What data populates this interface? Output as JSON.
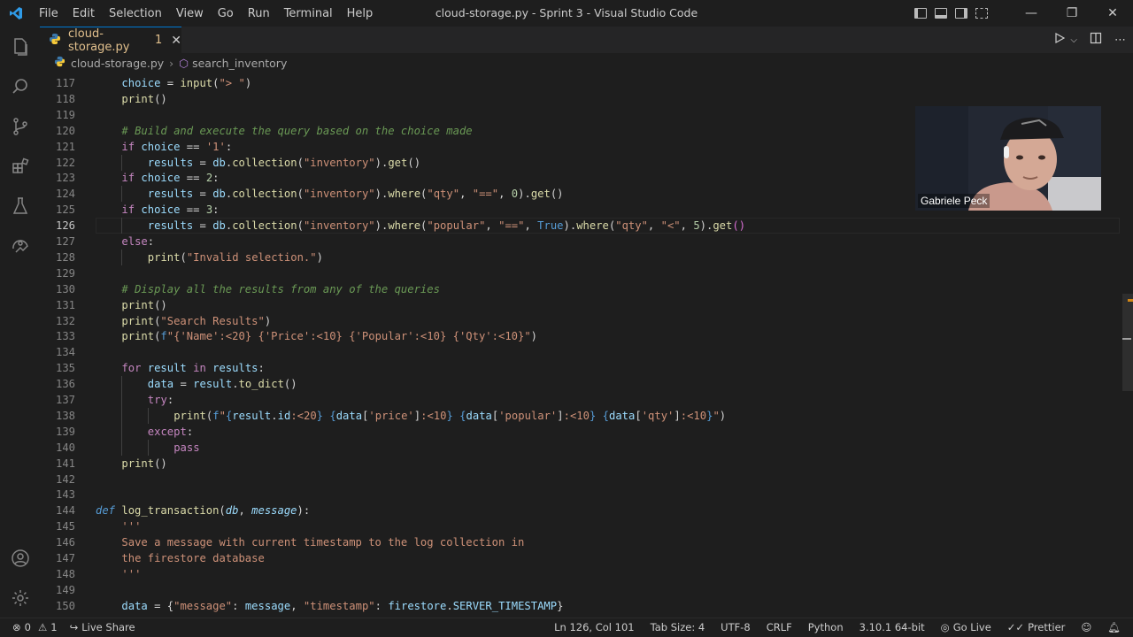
{
  "window": {
    "title": "cloud-storage.py - Sprint 3 - Visual Studio Code"
  },
  "menu": [
    "File",
    "Edit",
    "Selection",
    "View",
    "Go",
    "Run",
    "Terminal",
    "Help"
  ],
  "tab": {
    "label": "cloud-storage.py",
    "problems": "1"
  },
  "breadcrumb": {
    "file": "cloud-storage.py",
    "symbol": "search_inventory"
  },
  "webcam": {
    "name": "Gabriele Peck"
  },
  "status": {
    "errors": "0",
    "warnings": "1",
    "live_share": "Live Share",
    "position": "Ln 126, Col 101",
    "tab_size": "Tab Size: 4",
    "encoding": "UTF-8",
    "eol": "CRLF",
    "language": "Python",
    "interpreter": "3.10.1 64-bit",
    "go_live": "Go Live",
    "prettier": "Prettier"
  },
  "code": {
    "current_line": 126,
    "lines": [
      {
        "n": 117,
        "i": 1,
        "t": [
          [
            "v",
            "choice"
          ],
          [
            "p",
            " = "
          ],
          [
            "f",
            "input"
          ],
          [
            "p",
            "("
          ],
          [
            "s",
            "\"> \""
          ],
          [
            "p",
            ")"
          ]
        ]
      },
      {
        "n": 118,
        "i": 1,
        "t": [
          [
            "f",
            "print"
          ],
          [
            "p",
            "()"
          ]
        ]
      },
      {
        "n": 119,
        "i": 0,
        "t": []
      },
      {
        "n": 120,
        "i": 1,
        "t": [
          [
            "c",
            "# Build and execute the query based on the choice made"
          ]
        ]
      },
      {
        "n": 121,
        "i": 1,
        "t": [
          [
            "k",
            "if"
          ],
          [
            "v",
            " choice"
          ],
          [
            "p",
            " == "
          ],
          [
            "s",
            "'1'"
          ],
          [
            "p",
            ":"
          ]
        ]
      },
      {
        "n": 122,
        "i": 2,
        "t": [
          [
            "v",
            "results"
          ],
          [
            "p",
            " = "
          ],
          [
            "v",
            "db"
          ],
          [
            "p",
            "."
          ],
          [
            "f",
            "collection"
          ],
          [
            "p",
            "("
          ],
          [
            "s",
            "\"inventory\""
          ],
          [
            "p",
            ")."
          ],
          [
            "f",
            "get"
          ],
          [
            "p",
            "()"
          ]
        ]
      },
      {
        "n": 123,
        "i": 1,
        "t": [
          [
            "k",
            "if"
          ],
          [
            "v",
            " choice"
          ],
          [
            "p",
            " == "
          ],
          [
            "n",
            "2"
          ],
          [
            "p",
            ":"
          ]
        ]
      },
      {
        "n": 124,
        "i": 2,
        "t": [
          [
            "v",
            "results"
          ],
          [
            "p",
            " = "
          ],
          [
            "v",
            "db"
          ],
          [
            "p",
            "."
          ],
          [
            "f",
            "collection"
          ],
          [
            "p",
            "("
          ],
          [
            "s",
            "\"inventory\""
          ],
          [
            "p",
            ")."
          ],
          [
            "f",
            "where"
          ],
          [
            "p",
            "("
          ],
          [
            "s",
            "\"qty\""
          ],
          [
            "p",
            ", "
          ],
          [
            "s",
            "\"==\""
          ],
          [
            "p",
            ", "
          ],
          [
            "n",
            "0"
          ],
          [
            "p",
            ")."
          ],
          [
            "f",
            "get"
          ],
          [
            "p",
            "()"
          ]
        ]
      },
      {
        "n": 125,
        "i": 1,
        "t": [
          [
            "k",
            "if"
          ],
          [
            "v",
            " choice"
          ],
          [
            "p",
            " == "
          ],
          [
            "n",
            "3"
          ],
          [
            "p",
            ":"
          ]
        ]
      },
      {
        "n": 126,
        "i": 2,
        "t": [
          [
            "v",
            "results"
          ],
          [
            "p",
            " = "
          ],
          [
            "v",
            "db"
          ],
          [
            "p",
            "."
          ],
          [
            "f",
            "collection"
          ],
          [
            "p",
            "("
          ],
          [
            "s",
            "\"inventory\""
          ],
          [
            "p",
            ")."
          ],
          [
            "f",
            "where"
          ],
          [
            "p",
            "("
          ],
          [
            "s",
            "\"popular\""
          ],
          [
            "p",
            ", "
          ],
          [
            "s",
            "\"==\""
          ],
          [
            "p",
            ", "
          ],
          [
            "b",
            "True"
          ],
          [
            "p",
            ")."
          ],
          [
            "f",
            "where"
          ],
          [
            "p",
            "("
          ],
          [
            "s",
            "\"qty\""
          ],
          [
            "p",
            ", "
          ],
          [
            "s",
            "\"<\""
          ],
          [
            "p",
            ", "
          ],
          [
            "n",
            "5"
          ],
          [
            "p",
            ")."
          ],
          [
            "f",
            "get"
          ],
          [
            "br2",
            "()"
          ]
        ]
      },
      {
        "n": 127,
        "i": 1,
        "t": [
          [
            "k",
            "else"
          ],
          [
            "p",
            ":"
          ]
        ]
      },
      {
        "n": 128,
        "i": 2,
        "t": [
          [
            "f",
            "print"
          ],
          [
            "p",
            "("
          ],
          [
            "s",
            "\"Invalid selection.\""
          ],
          [
            "p",
            ")"
          ]
        ]
      },
      {
        "n": 129,
        "i": 0,
        "t": []
      },
      {
        "n": 130,
        "i": 1,
        "t": [
          [
            "c",
            "# Display all the results from any of the queries"
          ]
        ]
      },
      {
        "n": 131,
        "i": 1,
        "t": [
          [
            "f",
            "print"
          ],
          [
            "p",
            "()"
          ]
        ]
      },
      {
        "n": 132,
        "i": 1,
        "t": [
          [
            "f",
            "print"
          ],
          [
            "p",
            "("
          ],
          [
            "s",
            "\"Search Results\""
          ],
          [
            "p",
            ")"
          ]
        ]
      },
      {
        "n": 133,
        "i": 1,
        "t": [
          [
            "f",
            "print"
          ],
          [
            "p",
            "("
          ],
          [
            "b",
            "f"
          ],
          [
            "s",
            "\"{'Name':<20} {'Price':<10} {'Popular':<10} {'Qty':<10}\""
          ],
          [
            "p",
            ")"
          ]
        ]
      },
      {
        "n": 134,
        "i": 0,
        "t": []
      },
      {
        "n": 135,
        "i": 1,
        "t": [
          [
            "k",
            "for"
          ],
          [
            "v",
            " result"
          ],
          [
            "k",
            " in"
          ],
          [
            "v",
            " results"
          ],
          [
            "p",
            ":"
          ]
        ]
      },
      {
        "n": 136,
        "i": 2,
        "t": [
          [
            "v",
            "data"
          ],
          [
            "p",
            " = "
          ],
          [
            "v",
            "result"
          ],
          [
            "p",
            "."
          ],
          [
            "f",
            "to_dict"
          ],
          [
            "p",
            "()"
          ]
        ]
      },
      {
        "n": 137,
        "i": 2,
        "t": [
          [
            "k",
            "try"
          ],
          [
            "p",
            ":"
          ]
        ]
      },
      {
        "n": 138,
        "i": 3,
        "t": [
          [
            "f",
            "print"
          ],
          [
            "p",
            "("
          ],
          [
            "b",
            "f"
          ],
          [
            "s",
            "\""
          ],
          [
            "b",
            "{"
          ],
          [
            "v",
            "result"
          ],
          [
            "p",
            "."
          ],
          [
            "v",
            "id"
          ],
          [
            "s",
            ":<20"
          ],
          [
            "b",
            "}"
          ],
          [
            "s",
            " "
          ],
          [
            "b",
            "{"
          ],
          [
            "v",
            "data"
          ],
          [
            "p",
            "["
          ],
          [
            "s",
            "'price'"
          ],
          [
            "p",
            "]"
          ],
          [
            "s",
            ":<10"
          ],
          [
            "b",
            "}"
          ],
          [
            "s",
            " "
          ],
          [
            "b",
            "{"
          ],
          [
            "v",
            "data"
          ],
          [
            "p",
            "["
          ],
          [
            "s",
            "'popular'"
          ],
          [
            "p",
            "]"
          ],
          [
            "s",
            ":<10"
          ],
          [
            "b",
            "}"
          ],
          [
            "s",
            " "
          ],
          [
            "b",
            "{"
          ],
          [
            "v",
            "data"
          ],
          [
            "p",
            "["
          ],
          [
            "s",
            "'qty'"
          ],
          [
            "p",
            "]"
          ],
          [
            "s",
            ":<10"
          ],
          [
            "b",
            "}"
          ],
          [
            "s",
            "\""
          ],
          [
            "p",
            ")"
          ]
        ]
      },
      {
        "n": 139,
        "i": 2,
        "t": [
          [
            "k",
            "except"
          ],
          [
            "p",
            ":"
          ]
        ]
      },
      {
        "n": 140,
        "i": 3,
        "t": [
          [
            "k",
            "pass"
          ]
        ]
      },
      {
        "n": 141,
        "i": 1,
        "t": [
          [
            "f",
            "print"
          ],
          [
            "p",
            "()"
          ]
        ]
      },
      {
        "n": 142,
        "i": 0,
        "t": []
      },
      {
        "n": 143,
        "i": 0,
        "t": []
      },
      {
        "n": 144,
        "i": 0,
        "t": [
          [
            "kd",
            "def"
          ],
          [
            "p",
            " "
          ],
          [
            "f",
            "log_transaction"
          ],
          [
            "p",
            "("
          ],
          [
            "pa",
            "db"
          ],
          [
            "p",
            ", "
          ],
          [
            "pa",
            "message"
          ],
          [
            "p",
            "):"
          ]
        ]
      },
      {
        "n": 145,
        "i": 1,
        "t": [
          [
            "s",
            "'''"
          ]
        ]
      },
      {
        "n": 146,
        "i": 1,
        "t": [
          [
            "s",
            "Save a message with current timestamp to the log collection in"
          ]
        ]
      },
      {
        "n": 147,
        "i": 1,
        "t": [
          [
            "s",
            "the firestore database"
          ]
        ]
      },
      {
        "n": 148,
        "i": 1,
        "t": [
          [
            "s",
            "'''"
          ]
        ]
      },
      {
        "n": 149,
        "i": 0,
        "t": []
      },
      {
        "n": 150,
        "i": 1,
        "t": [
          [
            "v",
            "data"
          ],
          [
            "p",
            " = "
          ],
          [
            "p",
            "{"
          ],
          [
            "s",
            "\"message\""
          ],
          [
            "p",
            ": "
          ],
          [
            "v",
            "message"
          ],
          [
            "p",
            ", "
          ],
          [
            "s",
            "\"timestamp\""
          ],
          [
            "p",
            ": "
          ],
          [
            "v",
            "firestore"
          ],
          [
            "p",
            "."
          ],
          [
            "v",
            "SERVER_TIMESTAMP"
          ],
          [
            "p",
            "}"
          ]
        ]
      }
    ]
  }
}
